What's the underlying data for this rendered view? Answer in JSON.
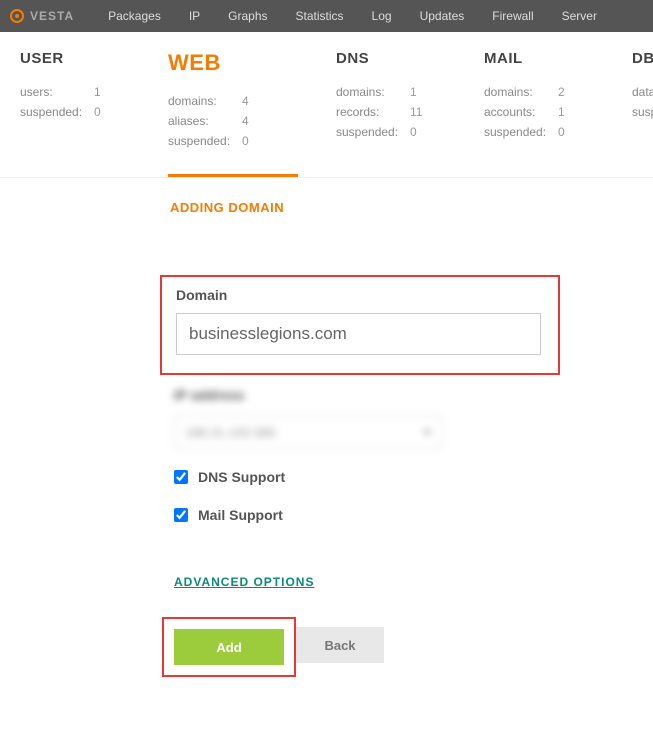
{
  "topnav": {
    "logo": "VESTA",
    "items": [
      "Packages",
      "IP",
      "Graphs",
      "Statistics",
      "Log",
      "Updates",
      "Firewall",
      "Server"
    ]
  },
  "stats": [
    {
      "title": "USER",
      "active": false,
      "lines": [
        {
          "label": "users:",
          "val": "1"
        },
        {
          "label": "suspended:",
          "val": "0"
        }
      ]
    },
    {
      "title": "WEB",
      "active": true,
      "lines": [
        {
          "label": "domains:",
          "val": "4"
        },
        {
          "label": "aliases:",
          "val": "4"
        },
        {
          "label": "suspended:",
          "val": "0"
        }
      ]
    },
    {
      "title": "DNS",
      "active": false,
      "lines": [
        {
          "label": "domains:",
          "val": "1"
        },
        {
          "label": "records:",
          "val": "11"
        },
        {
          "label": "suspended:",
          "val": "0"
        }
      ]
    },
    {
      "title": "MAIL",
      "active": false,
      "lines": [
        {
          "label": "domains:",
          "val": "2"
        },
        {
          "label": "accounts:",
          "val": "1"
        },
        {
          "label": "suspended:",
          "val": "0"
        }
      ]
    },
    {
      "title": "DB",
      "active": false,
      "lines": [
        {
          "label": "databases:",
          "val": ""
        },
        {
          "label": "suspended:",
          "val": ""
        }
      ]
    }
  ],
  "page_heading": "ADDING DOMAIN",
  "form": {
    "domain_label": "Domain",
    "domain_value": "businesslegions.com",
    "ip_label": "IP address",
    "ip_value": "188.31.193.388",
    "dns_label": "DNS Support",
    "mail_label": "Mail Support",
    "advanced_label": "ADVANCED OPTIONS",
    "add_label": "Add",
    "back_label": "Back"
  }
}
